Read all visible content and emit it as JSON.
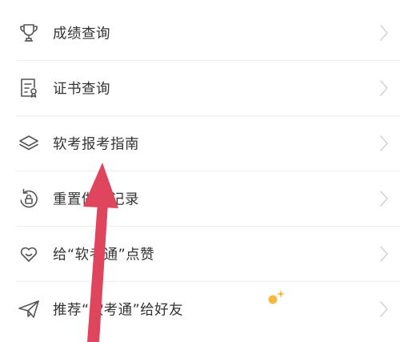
{
  "menu": {
    "items": [
      {
        "label": "成绩查询",
        "icon": "trophy-icon"
      },
      {
        "label": "证书查询",
        "icon": "certificate-icon"
      },
      {
        "label": "软考报考指南",
        "icon": "layers-icon"
      },
      {
        "label": "重置做题记录",
        "icon": "reset-icon"
      },
      {
        "label": "给“软考通”点赞",
        "icon": "heart-icon"
      },
      {
        "label": "推荐“软考通”给好友",
        "icon": "paper-plane-icon"
      }
    ]
  },
  "annotation": {
    "arrow_color": "#e0455e",
    "sparkle_color": "#f5b942"
  }
}
